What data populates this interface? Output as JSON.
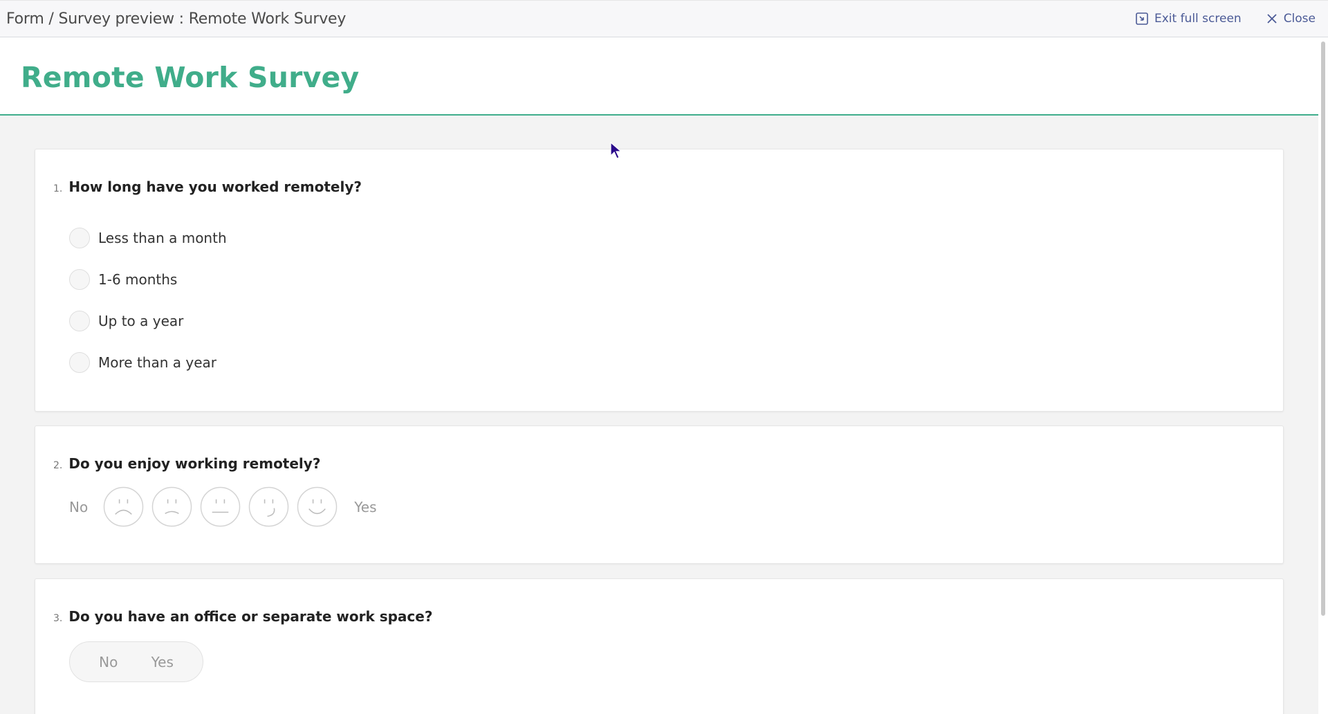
{
  "topbar": {
    "breadcrumb": [
      "Form",
      " / ",
      "Survey preview",
      " : ",
      "Remote Work Survey"
    ],
    "exit_fullscreen_label": "Exit full screen",
    "close_label": "Close"
  },
  "survey": {
    "title": "Remote Work Survey",
    "accent_color": "#40ad8a",
    "questions": [
      {
        "number": "1.",
        "text": "How long have you worked remotely?",
        "type": "radio",
        "options": [
          "Less than a month",
          "1-6 months",
          "Up to a year",
          "More than a year"
        ]
      },
      {
        "number": "2.",
        "text": "Do you enjoy working remotely?",
        "type": "smiley-rating",
        "low_label": "No",
        "high_label": "Yes",
        "faces": [
          "very-sad-face-icon",
          "sad-face-icon",
          "neutral-face-icon",
          "slight-smile-face-icon",
          "happy-face-icon"
        ]
      },
      {
        "number": "3.",
        "text": "Do you have an office or separate work space?",
        "type": "yes-no-toggle",
        "options": [
          "No",
          "Yes"
        ]
      }
    ]
  }
}
